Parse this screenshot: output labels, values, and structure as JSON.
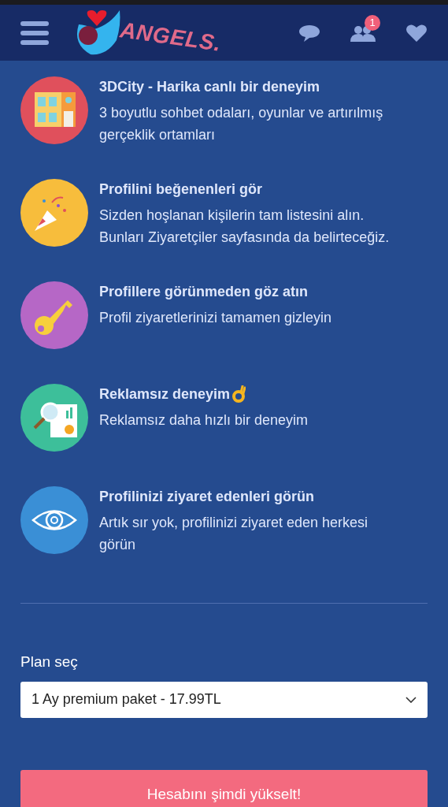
{
  "header": {
    "logo_text": "ANGELS.",
    "notifications_badge": "1"
  },
  "features": [
    {
      "kind": "building",
      "color": "#e0505c",
      "title": "3DCity - Harika canlı bir deneyim",
      "description": "3 boyutlu sohbet odaları, oyunlar ve artırılmış gerçeklik ortamları"
    },
    {
      "kind": "party",
      "color": "#f7bd3c",
      "title": "Profilini beğenenleri gör",
      "description": "Sizden hoşlanan kişilerin tam listesini alın. Bunları Ziyaretçiler sayfasında da belirteceğiz."
    },
    {
      "kind": "key",
      "color": "#b667c6",
      "title": "Profillere görünmeden göz atın",
      "description": "Profil ziyaretlerinizi tamamen gizleyin"
    },
    {
      "kind": "report",
      "color": "#3dbf9a",
      "title": "Reklamsız deneyim",
      "ok_hand": true,
      "description": "Reklamsız daha hızlı bir deneyim"
    },
    {
      "kind": "eye",
      "color": "#3a8fd6",
      "title": "Profilinizi ziyaret edenleri görün",
      "description": "Artık sır yok, profilinizi ziyaret eden herkesi görün"
    }
  ],
  "plan": {
    "label": "Plan seç",
    "value": "1 Ay premium paket - 17.99TL"
  },
  "upgrade_button": "Hesabını şimdi yükselt!"
}
